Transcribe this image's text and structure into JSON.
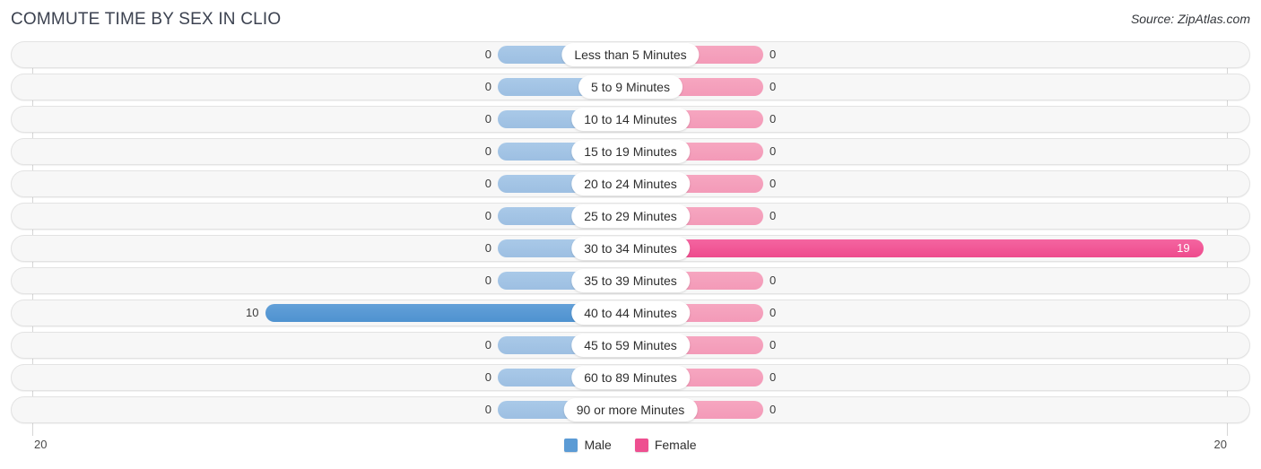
{
  "header": {
    "title": "COMMUTE TIME BY SEX IN CLIO",
    "source": "Source: ZipAtlas.com"
  },
  "axis": {
    "left_tick": "20",
    "right_tick": "20"
  },
  "legend": {
    "items": [
      {
        "label": "Male",
        "color": "#5b9bd5"
      },
      {
        "label": "Female",
        "color": "#ee4f90"
      }
    ]
  },
  "chart_data": {
    "type": "bar",
    "title": "COMMUTE TIME BY SEX IN CLIO",
    "subtitle": "Source: ZipAtlas.com",
    "orientation": "horizontal-diverging",
    "xlabel": "",
    "ylabel": "",
    "xlim": [
      20,
      20
    ],
    "axis_max_left": 20,
    "axis_max_right": 20,
    "grid": false,
    "legend_position": "bottom-center",
    "categories": [
      "Less than 5 Minutes",
      "5 to 9 Minutes",
      "10 to 14 Minutes",
      "15 to 19 Minutes",
      "20 to 24 Minutes",
      "25 to 29 Minutes",
      "30 to 34 Minutes",
      "35 to 39 Minutes",
      "40 to 44 Minutes",
      "45 to 59 Minutes",
      "60 to 89 Minutes",
      "90 or more Minutes"
    ],
    "series": [
      {
        "name": "Male",
        "color": "#5b9bd5",
        "side": "left",
        "values": [
          0,
          0,
          0,
          0,
          0,
          0,
          0,
          0,
          10,
          0,
          0,
          0
        ],
        "labels": [
          "0",
          "0",
          "0",
          "0",
          "0",
          "0",
          "0",
          "0",
          "10",
          "0",
          "0",
          "0"
        ]
      },
      {
        "name": "Female",
        "color": "#ee4f90",
        "side": "right",
        "values": [
          0,
          0,
          0,
          0,
          0,
          0,
          19,
          0,
          0,
          0,
          0,
          0
        ],
        "labels": [
          "0",
          "0",
          "0",
          "0",
          "0",
          "0",
          "19",
          "0",
          "0",
          "0",
          "0",
          "0"
        ]
      }
    ]
  }
}
